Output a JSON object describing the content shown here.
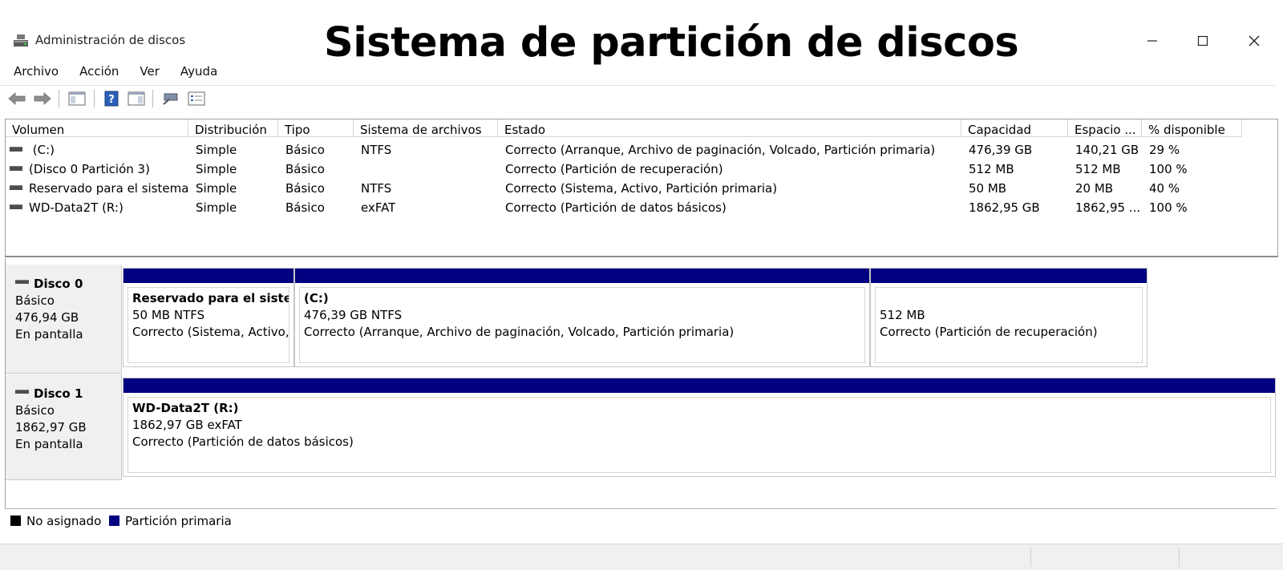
{
  "window": {
    "title": "Administración de discos",
    "overlay_title": "Sistema de partición de discos",
    "controls": [
      "minimize-icon",
      "maximize-icon",
      "close-icon"
    ]
  },
  "menu": {
    "items": [
      {
        "label": "Archivo"
      },
      {
        "label": "Acción"
      },
      {
        "label": "Ver"
      },
      {
        "label": "Ayuda"
      }
    ]
  },
  "toolbar": {
    "buttons": [
      "back-arrow-icon",
      "forward-arrow-icon",
      "console-tree-icon",
      "help-icon",
      "action-pane-icon",
      "connect-icon",
      "properties-icon"
    ]
  },
  "volume_list": {
    "columns": [
      "Volumen",
      "Distribución",
      "Tipo",
      "Sistema de archivos",
      "Estado",
      "Capacidad",
      "Espacio ...",
      "% disponible"
    ],
    "rows": [
      {
        "volume": " (C:)",
        "layout": "Simple",
        "type": "Básico",
        "fs": "NTFS",
        "status": "Correcto (Arranque, Archivo de paginación, Volcado, Partición primaria)",
        "capacity": "476,39 GB",
        "free": "140,21 GB",
        "pct": "29 %"
      },
      {
        "volume": "(Disco 0 Partición 3)",
        "layout": "Simple",
        "type": "Básico",
        "fs": "",
        "status": "Correcto (Partición de recuperación)",
        "capacity": "512 MB",
        "free": "512 MB",
        "pct": "100 %"
      },
      {
        "volume": "Reservado para el sistema",
        "layout": "Simple",
        "type": "Básico",
        "fs": "NTFS",
        "status": "Correcto (Sistema, Activo, Partición primaria)",
        "capacity": "50 MB",
        "free": "20 MB",
        "pct": "40 %"
      },
      {
        "volume": "WD-Data2T (R:)",
        "layout": "Simple",
        "type": "Básico",
        "fs": "exFAT",
        "status": "Correcto (Partición de datos básicos)",
        "capacity": "1862,95 GB",
        "free": "1862,95 ...",
        "pct": "100 %"
      }
    ]
  },
  "disks": [
    {
      "name": "Disco 0",
      "kind": "Básico",
      "size": "476,94 GB",
      "state": "En pantalla",
      "partitions": [
        {
          "title": "Reservado para el sistema",
          "size_fs": "50 MB NTFS",
          "status": "Correcto (Sistema, Activo, Partición primaria)"
        },
        {
          "title": " (C:)",
          "size_fs": "476,39 GB NTFS",
          "status": "Correcto (Arranque, Archivo de paginación, Volcado, Partición primaria)"
        },
        {
          "title": "",
          "size_fs": "512 MB",
          "status": "Correcto (Partición de recuperación)"
        }
      ]
    },
    {
      "name": "Disco 1",
      "kind": "Básico",
      "size": "1862,97 GB",
      "state": "En pantalla",
      "partitions": [
        {
          "title": "WD-Data2T  (R:)",
          "size_fs": "1862,97 GB exFAT",
          "status": "Correcto (Partición de datos básicos)"
        }
      ]
    }
  ],
  "legend": {
    "items": [
      {
        "label": "No asignado",
        "color": "#000000"
      },
      {
        "label": "Partición primaria",
        "color": "#000080"
      }
    ]
  }
}
